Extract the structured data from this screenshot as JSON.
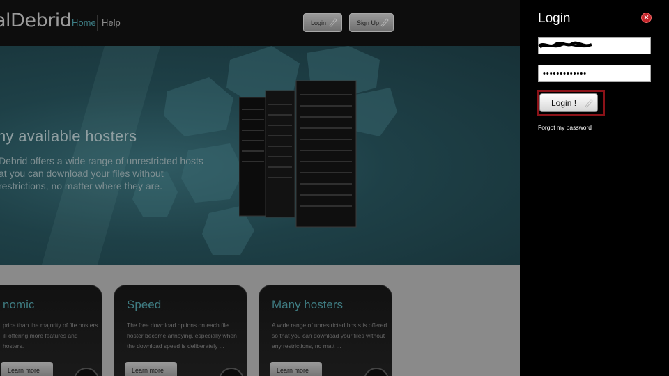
{
  "header": {
    "logo_text": "alDebrid",
    "nav": {
      "home": "Home",
      "help": "Help"
    },
    "login_button": "Login",
    "signup_button": "Sign Up"
  },
  "hero": {
    "title": "ny available hosters",
    "lines": [
      "Debrid offers a wide range of unrestricted hosts",
      "at you can download your files without",
      "restrictions, no matter where they are."
    ]
  },
  "features": [
    {
      "title": "nomic",
      "text": "price than the majority of file hosters ill offering more features and hosters.",
      "button": "Learn more"
    },
    {
      "title": "Speed",
      "text": "The free download options on each file hoster become annoying, especially when the download speed is deliberately ...",
      "button": "Learn more"
    },
    {
      "title": "Many hosters",
      "text": "A wide range of unrestricted hosts is offered so that you can download your files without any restrictions, no matt ...",
      "button": "Learn more"
    }
  ],
  "login_panel": {
    "title": "Login",
    "close_label": "×",
    "username_value": "",
    "password_value": "•••••••••••••",
    "submit_label": "Login !",
    "forgot_link": "Forgot my password"
  },
  "colors": {
    "accent_teal": "#3e7f86",
    "highlight_red": "#8b1218",
    "close_red": "#c4262b"
  }
}
